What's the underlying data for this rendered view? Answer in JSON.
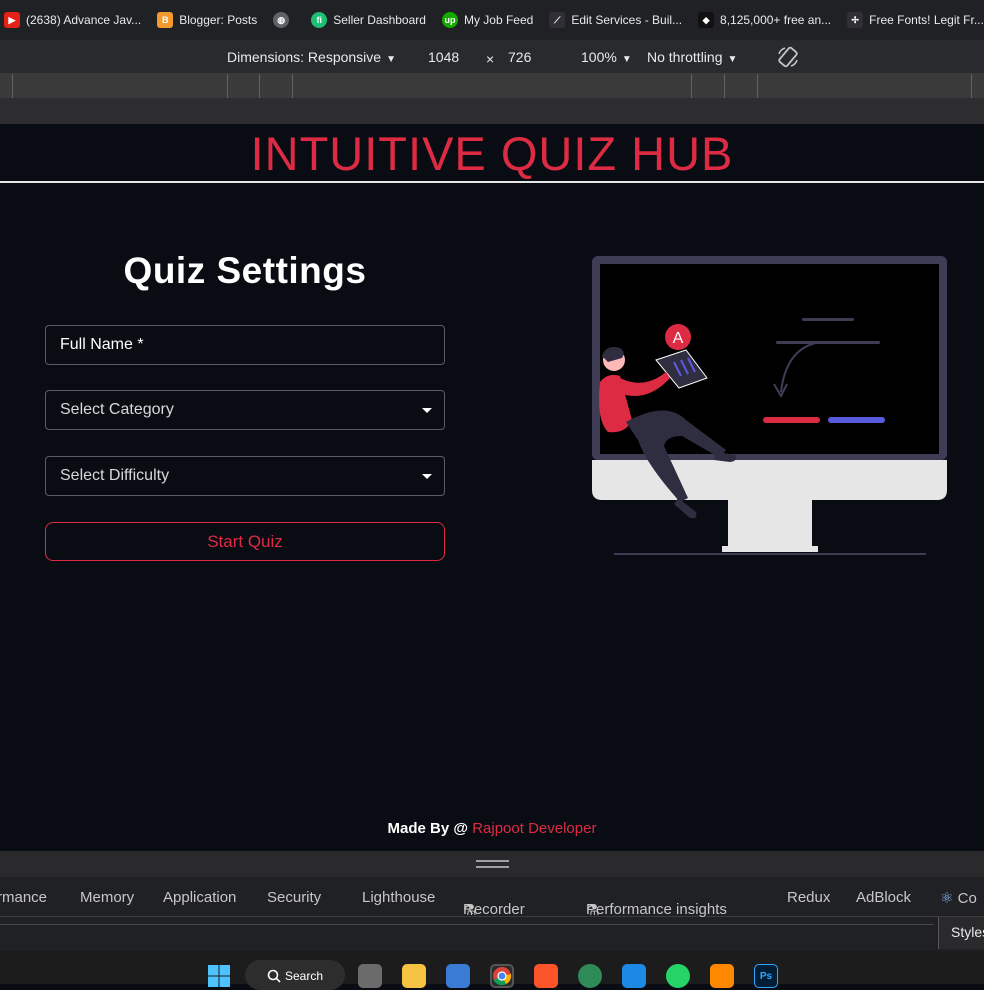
{
  "bookmarks": [
    {
      "label": "(2638) Advance Jav...",
      "icon": "youtube-icon",
      "color": "#e62117",
      "glyph": "▶"
    },
    {
      "label": "Blogger: Posts",
      "icon": "blogger-icon",
      "color": "#f29a2e",
      "glyph": "B"
    },
    {
      "label": "",
      "icon": "globe-icon",
      "color": "#5f6368",
      "glyph": "◍"
    },
    {
      "label": "Seller Dashboard",
      "icon": "fiverr-icon",
      "color": "#1dbf73",
      "glyph": "fi"
    },
    {
      "label": "My Job Feed",
      "icon": "upwork-icon",
      "color": "#14a800",
      "glyph": "up"
    },
    {
      "label": "Edit Services - Buil...",
      "icon": "edit-services-icon",
      "color": "#2f2f35",
      "glyph": "⟋"
    },
    {
      "label": "8,125,000+ free an...",
      "icon": "freepik-icon",
      "color": "#111111",
      "glyph": "◆"
    },
    {
      "label": "Free Fonts! Legit Fr...",
      "icon": "fonts-icon",
      "color": "#2f2f35",
      "glyph": "✢"
    }
  ],
  "device_toolbar": {
    "dimensions_label": "Dimensions: Responsive",
    "width": "1048",
    "times": "×",
    "height": "726",
    "zoom": "100%",
    "throttling": "No throttling"
  },
  "page": {
    "site_title": "INTUITIVE QUIZ HUB",
    "settings_title": "Quiz Settings",
    "full_name_placeholder": "Full Name *",
    "category_placeholder": "Select Category",
    "difficulty_placeholder": "Select Difficulty",
    "start_button": "Start Quiz",
    "illustration_badge": "A",
    "footer_prefix": "Made By @ ",
    "footer_link": "Rajpoot Developer",
    "accent_color": "#dc2b43"
  },
  "devtools": {
    "tabs": [
      "rmance",
      "Memory",
      "Application",
      "Security",
      "Lighthouse",
      "Recorder",
      "Performance insights",
      "Redux",
      "AdBlock",
      "Co"
    ],
    "flask_icon": "⚗",
    "styles_tab": "Styles"
  },
  "taskbar": {
    "search_label": "Search",
    "apps": [
      "windows-start-icon",
      "file-manager-icon",
      "folder-icon",
      "store-icon",
      "chrome-icon",
      "brave-icon",
      "network-globe-icon",
      "vscode-icon",
      "whatsapp-icon",
      "vlc-icon",
      "photoshop-icon"
    ]
  }
}
